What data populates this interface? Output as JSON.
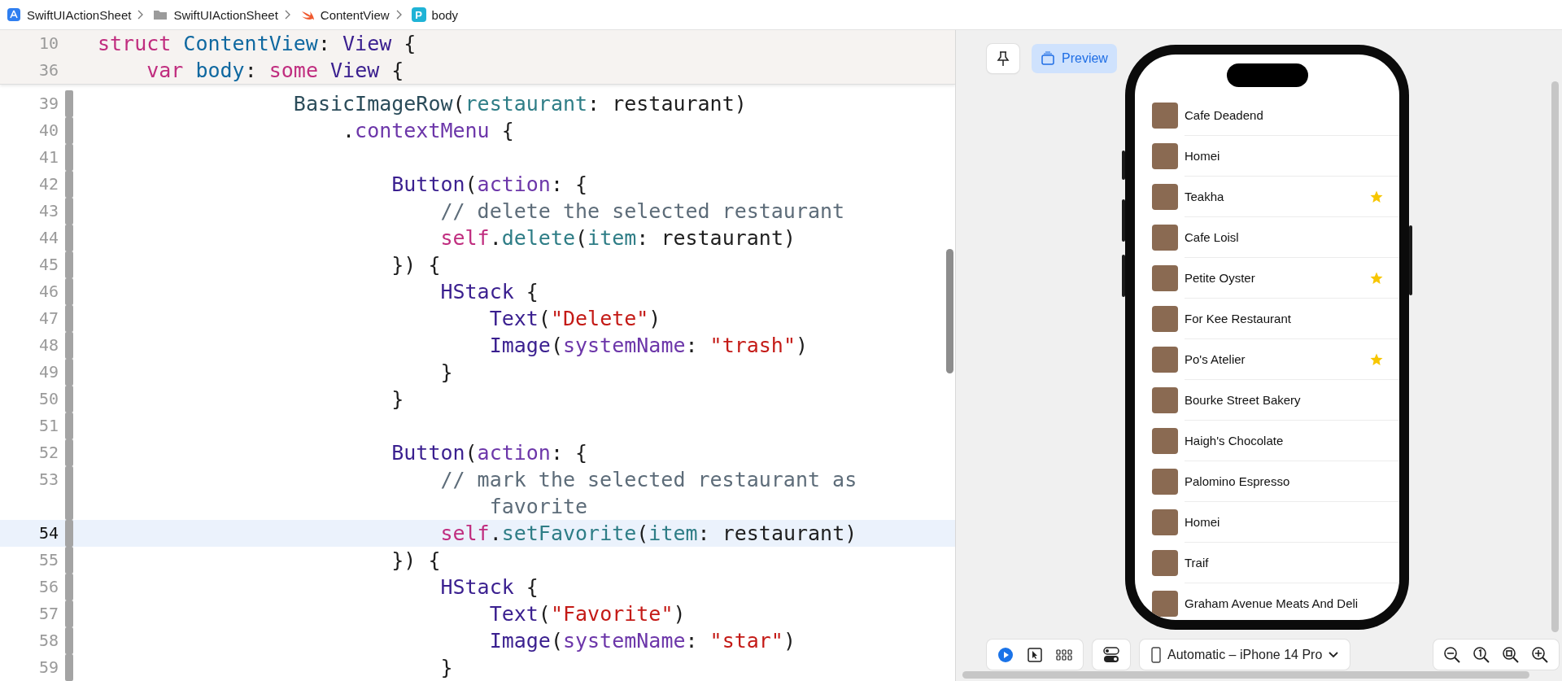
{
  "breadcrumb": [
    {
      "kind": "app",
      "label": "SwiftUIActionSheet"
    },
    {
      "kind": "folder",
      "label": "SwiftUIActionSheet"
    },
    {
      "kind": "swift",
      "label": "ContentView"
    },
    {
      "kind": "property",
      "label": "body",
      "badge": "P"
    }
  ],
  "editor": {
    "sticky_lines": [
      {
        "number": "10",
        "tokens": [
          {
            "text": "struct ",
            "kind": "keyword"
          },
          {
            "text": "ContentView",
            "kind": "decl"
          },
          {
            "text": ": ",
            "kind": "plain"
          },
          {
            "text": "View",
            "kind": "type"
          },
          {
            "text": " {",
            "kind": "plain"
          }
        ]
      },
      {
        "number": "36",
        "tokens": [
          {
            "text": "    var ",
            "kind": "keyword"
          },
          {
            "text": "body",
            "kind": "decl"
          },
          {
            "text": ": ",
            "kind": "plain"
          },
          {
            "text": "some ",
            "kind": "keyword"
          },
          {
            "text": "View",
            "kind": "type"
          },
          {
            "text": " {",
            "kind": "plain"
          }
        ]
      }
    ],
    "lines": [
      {
        "number": "39",
        "current": false,
        "tokens": [
          {
            "text": "                BasicImageRow",
            "kind": "project"
          },
          {
            "text": "(",
            "kind": "plain"
          },
          {
            "text": "restaurant",
            "kind": "member"
          },
          {
            "text": ": restaurant)",
            "kind": "plain"
          }
        ]
      },
      {
        "number": "40",
        "current": false,
        "tokens": [
          {
            "text": "                    .",
            "kind": "plain"
          },
          {
            "text": "contextMenu",
            "kind": "method"
          },
          {
            "text": " {",
            "kind": "plain"
          }
        ]
      },
      {
        "number": "41",
        "current": false
      },
      {
        "number": "42",
        "current": false,
        "tokens": [
          {
            "text": "                        Button",
            "kind": "type"
          },
          {
            "text": "(",
            "kind": "plain"
          },
          {
            "text": "action",
            "kind": "method"
          },
          {
            "text": ": {",
            "kind": "plain"
          }
        ]
      },
      {
        "number": "43",
        "current": false,
        "tokens": [
          {
            "text": "                            // delete the selected restaurant",
            "kind": "comment"
          }
        ]
      },
      {
        "number": "44",
        "current": false,
        "tokens": [
          {
            "text": "                            self",
            "kind": "keyword"
          },
          {
            "text": ".",
            "kind": "plain"
          },
          {
            "text": "delete",
            "kind": "member"
          },
          {
            "text": "(",
            "kind": "plain"
          },
          {
            "text": "item",
            "kind": "member"
          },
          {
            "text": ": restaurant)",
            "kind": "plain"
          }
        ]
      },
      {
        "number": "45",
        "current": false,
        "tokens": [
          {
            "text": "                        }) {",
            "kind": "plain"
          }
        ]
      },
      {
        "number": "46",
        "current": false,
        "tokens": [
          {
            "text": "                            HStack",
            "kind": "type"
          },
          {
            "text": " {",
            "kind": "plain"
          }
        ]
      },
      {
        "number": "47",
        "current": false,
        "tokens": [
          {
            "text": "                                Text",
            "kind": "type"
          },
          {
            "text": "(",
            "kind": "plain"
          },
          {
            "text": "\"Delete\"",
            "kind": "string"
          },
          {
            "text": ")",
            "kind": "plain"
          }
        ]
      },
      {
        "number": "48",
        "current": false,
        "tokens": [
          {
            "text": "                                Image",
            "kind": "type"
          },
          {
            "text": "(",
            "kind": "plain"
          },
          {
            "text": "systemName",
            "kind": "method"
          },
          {
            "text": ": ",
            "kind": "plain"
          },
          {
            "text": "\"trash\"",
            "kind": "string"
          },
          {
            "text": ")",
            "kind": "plain"
          }
        ]
      },
      {
        "number": "49",
        "current": false,
        "tokens": [
          {
            "text": "                            }",
            "kind": "plain"
          }
        ]
      },
      {
        "number": "50",
        "current": false,
        "tokens": [
          {
            "text": "                        }",
            "kind": "plain"
          }
        ]
      },
      {
        "number": "51",
        "current": false
      },
      {
        "number": "52",
        "current": false,
        "tokens": [
          {
            "text": "                        Button",
            "kind": "type"
          },
          {
            "text": "(",
            "kind": "plain"
          },
          {
            "text": "action",
            "kind": "method"
          },
          {
            "text": ": {",
            "kind": "plain"
          }
        ]
      },
      {
        "number": "53",
        "current": false,
        "tokens": [
          {
            "text": "                            // mark the selected restaurant as favorite",
            "kind": "comment"
          }
        ]
      },
      {
        "number": "54",
        "current": true,
        "tokens": [
          {
            "text": "                            self",
            "kind": "keyword"
          },
          {
            "text": ".",
            "kind": "plain"
          },
          {
            "text": "setFavorite",
            "kind": "member"
          },
          {
            "text": "(",
            "kind": "plain"
          },
          {
            "text": "item",
            "kind": "member"
          },
          {
            "text": ": restaurant)",
            "kind": "plain"
          }
        ]
      },
      {
        "number": "55",
        "current": false,
        "tokens": [
          {
            "text": "                        }) {",
            "kind": "plain"
          }
        ]
      },
      {
        "number": "56",
        "current": false,
        "tokens": [
          {
            "text": "                            HStack",
            "kind": "type"
          },
          {
            "text": " {",
            "kind": "plain"
          }
        ]
      },
      {
        "number": "57",
        "current": false,
        "tokens": [
          {
            "text": "                                Text",
            "kind": "type"
          },
          {
            "text": "(",
            "kind": "plain"
          },
          {
            "text": "\"Favorite\"",
            "kind": "string"
          },
          {
            "text": ")",
            "kind": "plain"
          }
        ]
      },
      {
        "number": "58",
        "current": false,
        "tokens": [
          {
            "text": "                                Image",
            "kind": "type"
          },
          {
            "text": "(",
            "kind": "plain"
          },
          {
            "text": "systemName",
            "kind": "method"
          },
          {
            "text": ": ",
            "kind": "plain"
          },
          {
            "text": "\"star\"",
            "kind": "string"
          },
          {
            "text": ")",
            "kind": "plain"
          }
        ]
      },
      {
        "number": "59",
        "current": false,
        "tokens": [
          {
            "text": "                            }",
            "kind": "plain"
          }
        ]
      }
    ]
  },
  "preview": {
    "pin": {
      "selected": false
    },
    "preview_button": {
      "label": "Preview",
      "selected": true
    },
    "restaurants": [
      {
        "name": "Cafe Deadend",
        "favorite": false
      },
      {
        "name": "Homei",
        "favorite": false
      },
      {
        "name": "Teakha",
        "favorite": true
      },
      {
        "name": "Cafe Loisl",
        "favorite": false
      },
      {
        "name": "Petite Oyster",
        "favorite": true
      },
      {
        "name": "For Kee Restaurant",
        "favorite": false
      },
      {
        "name": "Po's Atelier",
        "favorite": true
      },
      {
        "name": "Bourke Street Bakery",
        "favorite": false
      },
      {
        "name": "Haigh's Chocolate",
        "favorite": false
      },
      {
        "name": "Palomino Espresso",
        "favorite": false
      },
      {
        "name": "Homei",
        "favorite": false
      },
      {
        "name": "Traif",
        "favorite": false
      },
      {
        "name": "Graham Avenue Meats And Deli",
        "favorite": false
      }
    ],
    "modes": [
      {
        "kind": "live",
        "selected": true
      },
      {
        "kind": "select",
        "selected": false
      },
      {
        "kind": "variants",
        "selected": false
      }
    ],
    "device": "Automatic – iPhone 14 Pro"
  }
}
